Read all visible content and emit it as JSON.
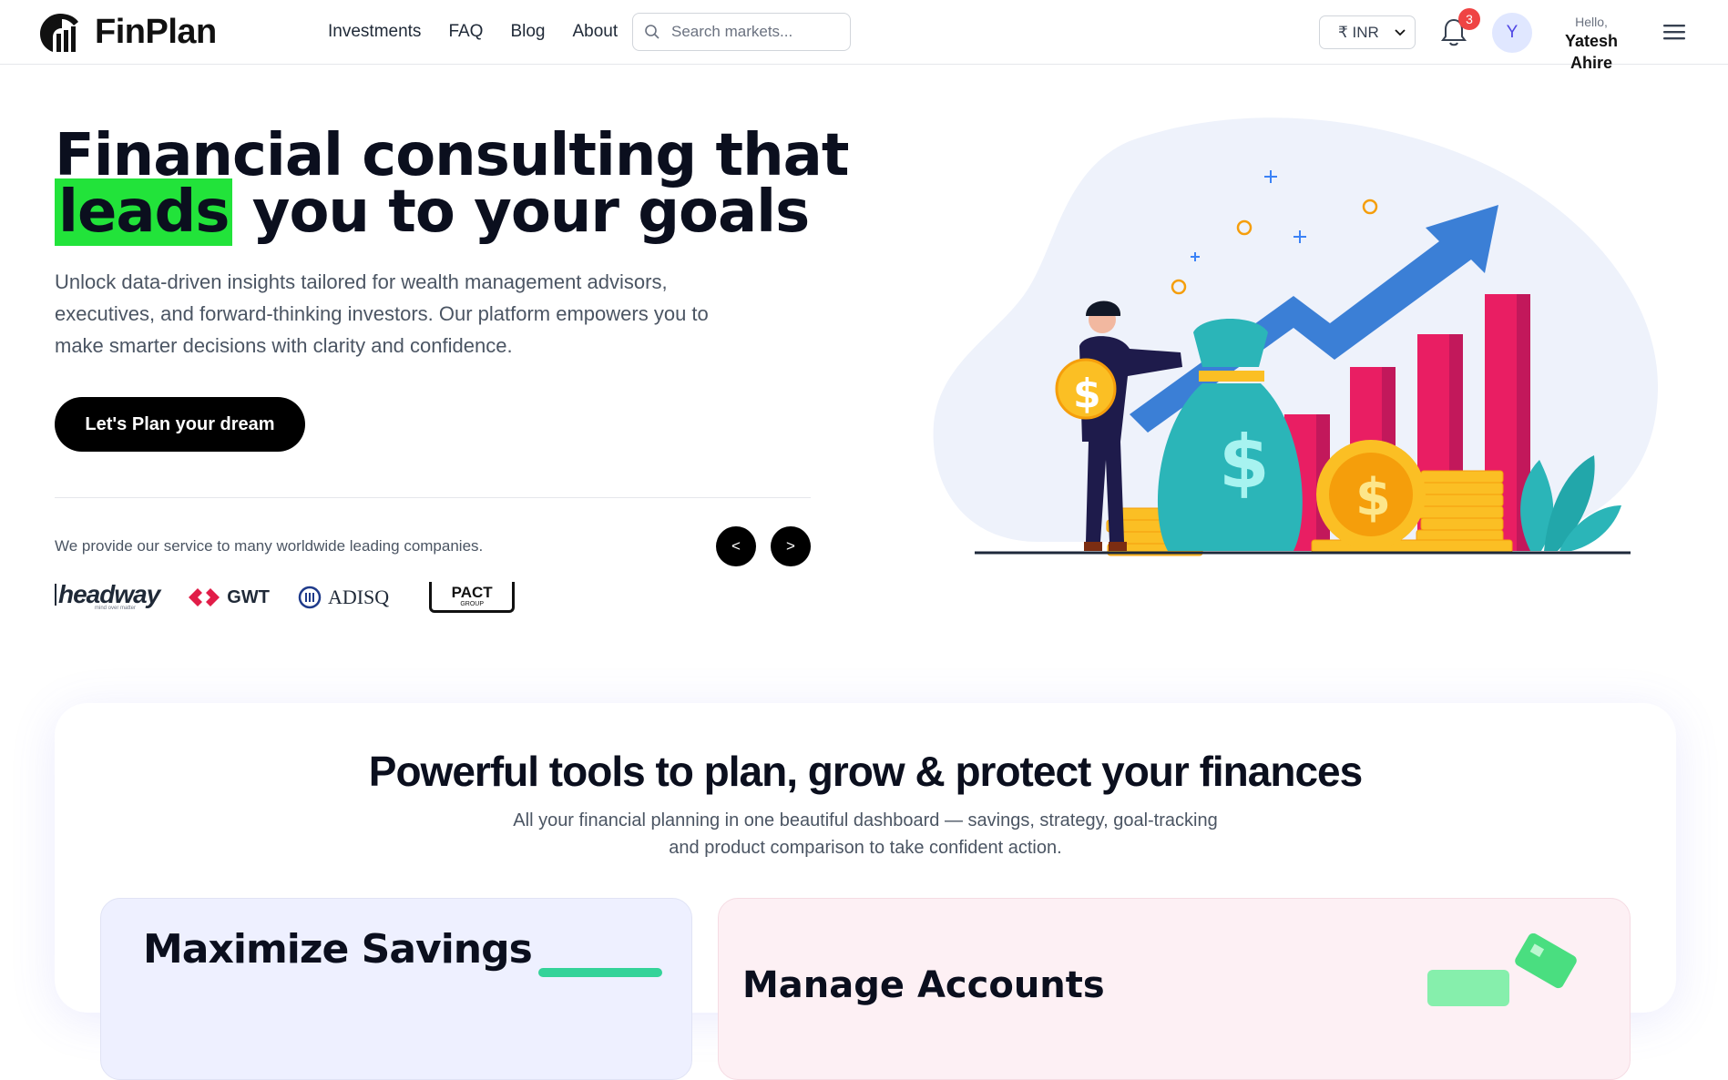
{
  "header": {
    "brand": "FinPlan",
    "nav": [
      "Investments",
      "FAQ",
      "Blog",
      "About"
    ],
    "search_placeholder": "Search markets...",
    "currency": "₹ INR",
    "notifications_count": "3",
    "avatar_initial": "Y",
    "greeting": "Hello,",
    "user_name": "Yatesh Ahire"
  },
  "hero": {
    "title_line1": "Financial consulting that",
    "title_highlight": "leads",
    "title_line2_rest": " you to your goals",
    "subtitle": "Unlock data-driven insights tailored for wealth management advisors, executives, and forward-thinking investors. Our platform empowers you to make smarter decisions with clarity and confidence.",
    "cta_label": "Let's Plan your dream",
    "clients_text": "We provide our service to many worldwide leading companies.",
    "prev_label": "<",
    "next_label": ">",
    "clients": {
      "headway": "headway",
      "headway_tagline": "mind over matter",
      "gwt": "GWT",
      "adisq": "ADISQ",
      "pact": "PACT",
      "pact_sub": "GROUP"
    }
  },
  "tools": {
    "title": "Powerful tools to plan, grow & protect your finances",
    "subtitle": "All your financial planning in one beautiful dashboard — savings, strategy, goal-tracking and product comparison to take confident action.",
    "cards": [
      {
        "title": "Maximize Savings"
      },
      {
        "title": "Manage Accounts"
      }
    ]
  },
  "colors": {
    "highlight": "#22e33a",
    "badge": "#ef4444",
    "bar_red": "#e91e63",
    "coin": "#fbbf24",
    "bag": "#2bb5b8",
    "arrow": "#3b82f6"
  }
}
